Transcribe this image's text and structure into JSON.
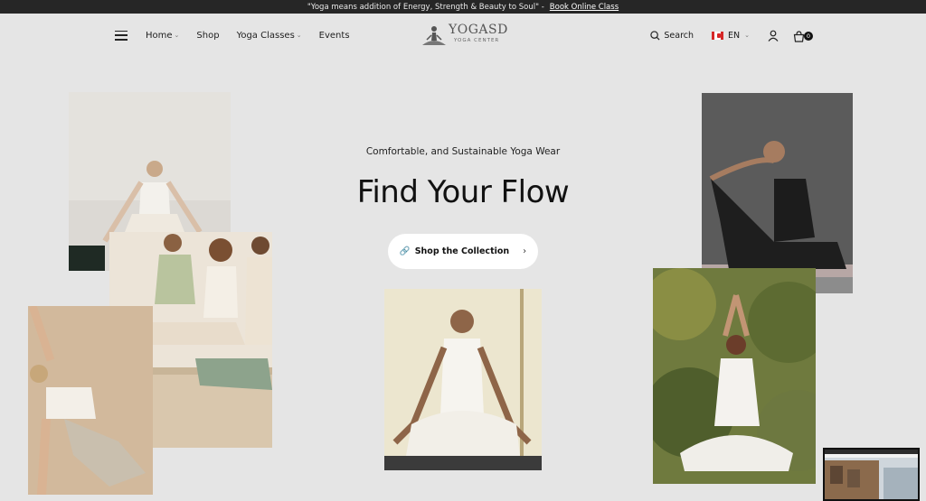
{
  "announcement": {
    "quote": "\"Yoga means addition of Energy, Strength & Beauty to Soul\" -",
    "link": "Book Online Class"
  },
  "nav": {
    "items": [
      {
        "label": "Home",
        "dropdown": true
      },
      {
        "label": "Shop",
        "dropdown": false
      },
      {
        "label": "Yoga Classes",
        "dropdown": true
      },
      {
        "label": "Events",
        "dropdown": false
      }
    ]
  },
  "logo": {
    "name": "YOGASD",
    "tagline": "YOGA CENTER"
  },
  "header_right": {
    "search_label": "Search",
    "language": "EN",
    "cart_count": "0"
  },
  "hero": {
    "subtitle": "Comfortable, and Sustainable Yoga Wear",
    "title": "Find Your Flow",
    "cta_label": "Shop the Collection"
  },
  "icons": [
    "hamburger-menu-icon",
    "search-icon",
    "canada-flag-icon",
    "user-icon",
    "cart-icon",
    "link-icon",
    "chevron-right-icon"
  ],
  "colors": {
    "background": "#e5e5e5",
    "topbar": "#262626",
    "button": "#ffffff"
  }
}
